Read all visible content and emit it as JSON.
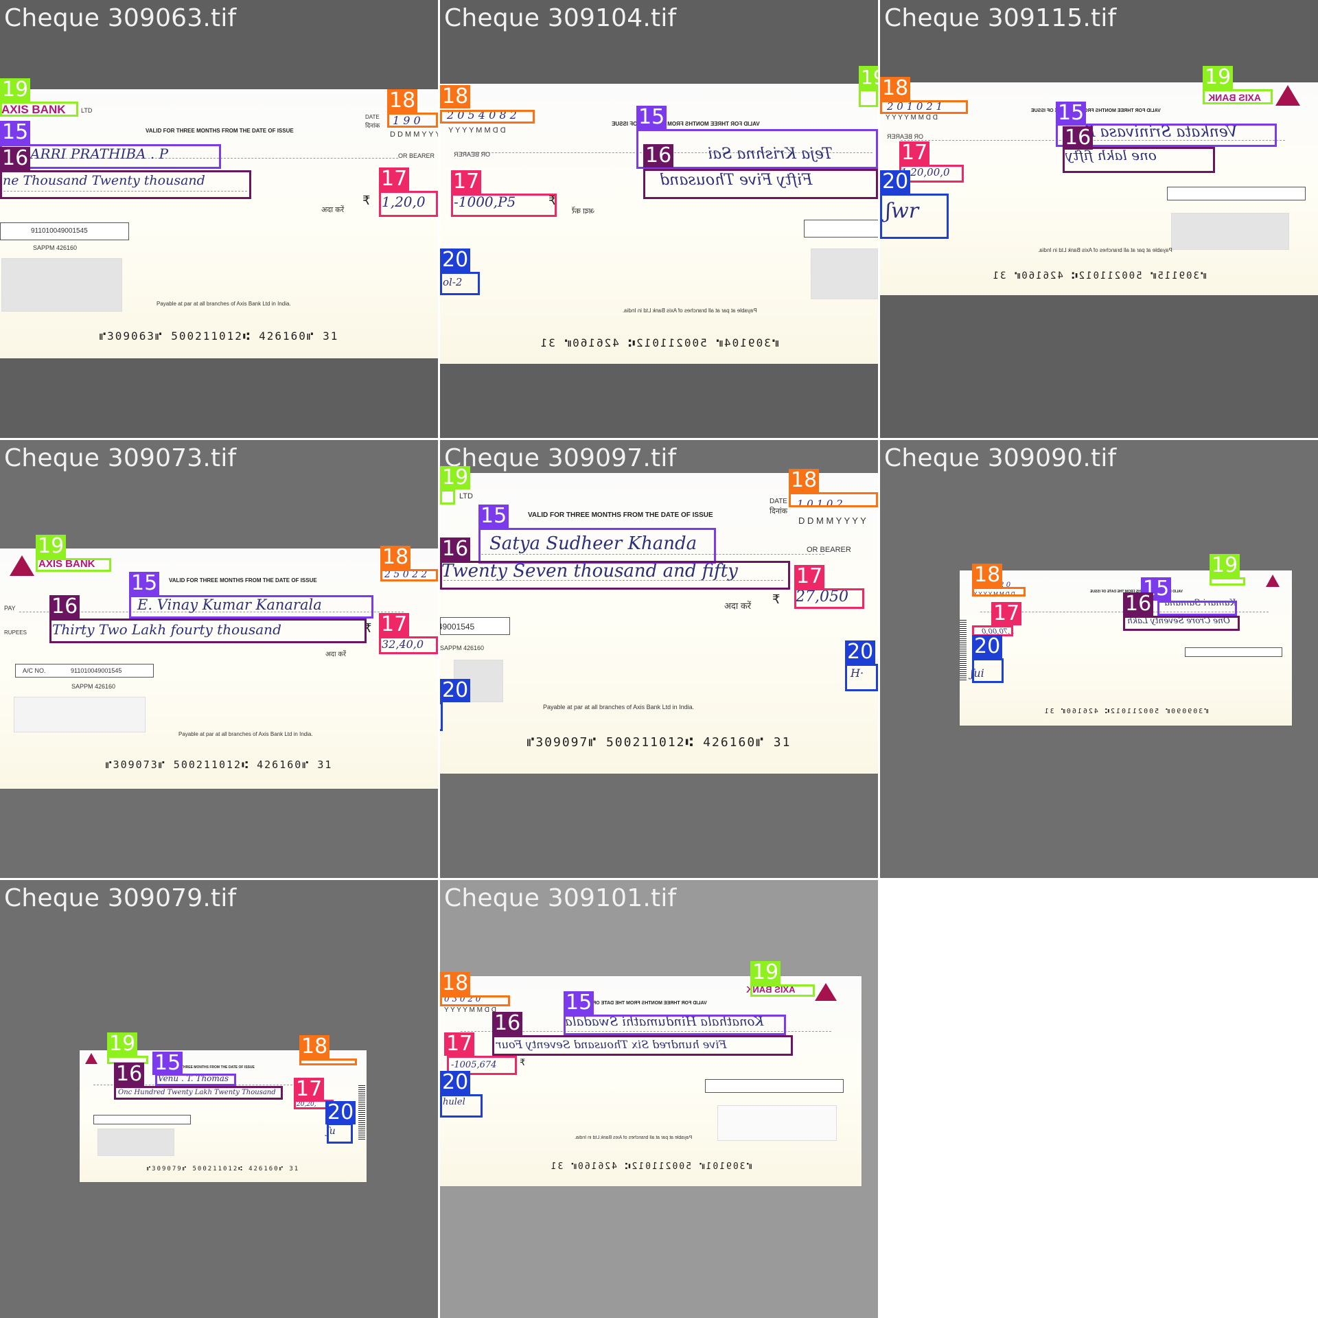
{
  "tiles": [
    {
      "title": "Cheque 309063.tif"
    },
    {
      "title": "Cheque 309104.tif"
    },
    {
      "title": "Cheque 309115.tif"
    },
    {
      "title": "Cheque 309073.tif"
    },
    {
      "title": "Cheque 309097.tif"
    },
    {
      "title": "Cheque 309090.tif"
    },
    {
      "title": "Cheque 309079.tif"
    },
    {
      "title": "Cheque 309101.tif"
    }
  ],
  "labels": {
    "payee": "15",
    "amount_words": "16",
    "amount_digits": "17",
    "date": "18",
    "bank_name": "19",
    "signature": "20"
  },
  "label_colors": {
    "15": "#7c3aed",
    "16": "#6b1560",
    "17": "#ee2766",
    "18": "#f97316",
    "19": "#8ef01e",
    "20": "#1d3fd6"
  },
  "print": {
    "bank": "AXIS BANK",
    "ltd": "LTD",
    "valid": "VALID FOR THREE MONTHS FROM THE DATE OF ISSUE",
    "date_label": "DATE",
    "date_hindi": "दिनांक",
    "ddmmyyyy": "D D M M Y Y Y Y",
    "or_bearer": "OR BEARER",
    "ada_kare": "अदा करें",
    "rupee": "₹",
    "account": "911010049001545",
    "sappm": "SAPPM  426160",
    "payable": "Payable at par at all branches of Axis Bank Ltd in India.",
    "pay": "PAY",
    "rupees": "RUPEES",
    "ac_no": "A/C NO."
  },
  "cheques": {
    "c309063": {
      "payee": "ARRI  PRATHIBA . P",
      "words": "ne Thousand Twenty  thousand",
      "amount": "1,20,0",
      "date": "1 9 0",
      "micr": "⑈309063⑈  500211012⑆  426160⑈  31"
    },
    "c309104": {
      "payee": "Teja Krishna Sai",
      "words": "Fifty Five Thousand",
      "amount": "-1000,P5",
      "date": "2 0 5 4 0 8 2",
      "micr": "⑈309104⑈  500211012⑆  426160⑈  31"
    },
    "c309115": {
      "payee": "Venkata Srinivasa Rao",
      "words": "one lakh fifty",
      "amount": "1,20,00,0",
      "date": "2 0 1 0 2 1",
      "micr": "⑈309115⑈  500211012⑆  426160⑈  31"
    },
    "c309073": {
      "payee": "E. Vinay Kumar Kanarala",
      "words": "Thirty Two Lakh fourty thousand",
      "amount": "32,40,0",
      "date": "2 5 0 2 2",
      "micr": "⑈309073⑈  500211012⑆  426160⑈  31"
    },
    "c309097": {
      "payee": "Satya Sudheer Khanda",
      "words": "Twenty Seven thousand and fifty",
      "amount": "27,050",
      "date": "1 0 1 0 2",
      "micr": "⑈309097⑈  500211012⑆  426160⑈  31"
    },
    "c309090": {
      "payee": "Kumari Samana",
      "words": "One Crore Seventy Lakh",
      "amount": "1,70,00,0",
      "date": "2 0 1 0 2 0",
      "micr": "⑈309090⑈  500211012⑆  426160⑈  31"
    },
    "c309079": {
      "payee": "Venu . T. Thomas",
      "words": "Onc Hundred Twenty Lakh Twenty Thousand",
      "amount": "20,20,",
      "date": "",
      "micr": "⑈309079⑈  500211012⑆  426160⑈  31"
    },
    "c309101": {
      "payee": "Konathala Hindumathi Swadala",
      "words": "Five hundred Six Thousand Seventy Four",
      "amount": "-1005,674",
      "date": "0 3 0 2 0",
      "micr": "⑈309101⑈  500211012⑆  426160⑈  31"
    }
  }
}
